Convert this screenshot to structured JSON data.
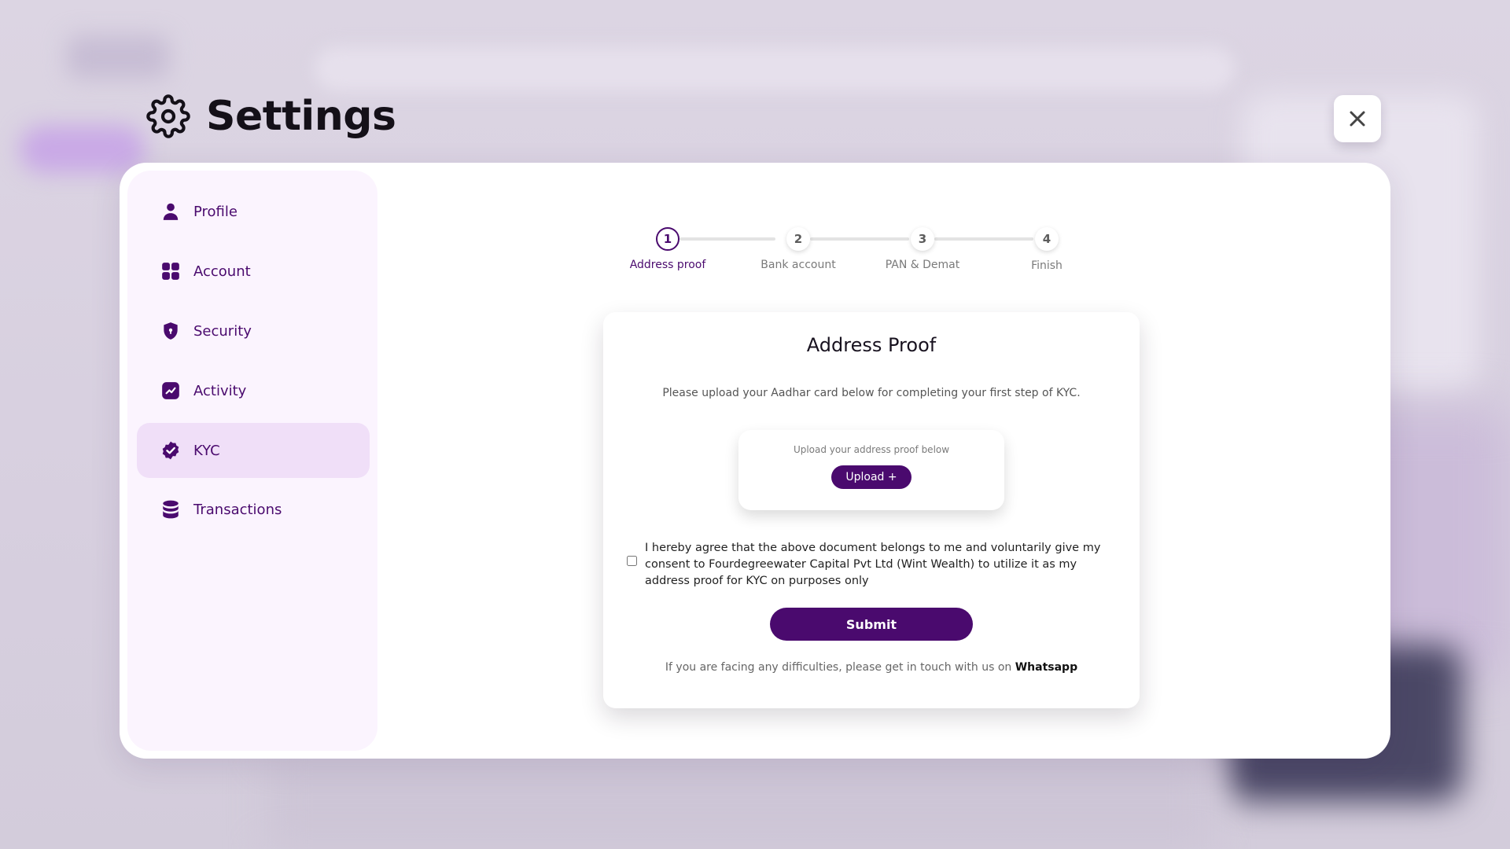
{
  "header": {
    "title": "Settings",
    "close_label": "close"
  },
  "sidebar": {
    "items": [
      {
        "label": "Profile",
        "icon": "user-icon"
      },
      {
        "label": "Account",
        "icon": "grid-icon"
      },
      {
        "label": "Security",
        "icon": "shield-icon"
      },
      {
        "label": "Activity",
        "icon": "activity-chart-icon"
      },
      {
        "label": "KYC",
        "icon": "verified-badge-icon",
        "active": true
      },
      {
        "label": "Transactions",
        "icon": "database-icon"
      }
    ]
  },
  "stepper": {
    "steps": [
      {
        "number": "1",
        "label": "Address proof",
        "active": true
      },
      {
        "number": "2",
        "label": "Bank account"
      },
      {
        "number": "3",
        "label": "PAN & Demat"
      },
      {
        "number": "4",
        "label": "Finish"
      }
    ]
  },
  "card": {
    "title": "Address Proof",
    "description": "Please upload your Aadhar card below for completing your first step of KYC.",
    "upload_hint": "Upload your address proof below",
    "upload_button": "Upload +",
    "consent_text": "I hereby agree that the above document belongs to me and voluntarily give my consent to Fourdegreewater Capital Pvt Ltd (Wint Wealth) to utilize it as my address proof for KYC on purposes only",
    "consent_checked": false,
    "submit_button": "Submit",
    "help_text": "If you are facing any difficulties, please get in touch with us on",
    "help_link": "Whatsapp"
  },
  "colors": {
    "accent": "#4a0a6e",
    "active_nav_bg": "#f0dff8",
    "sidebar_bg": "#fbf4fe"
  }
}
